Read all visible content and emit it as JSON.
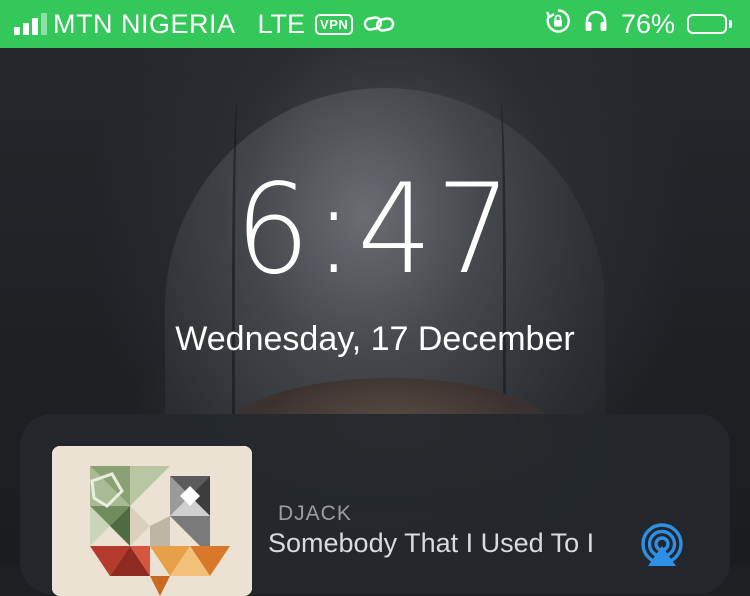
{
  "status_bar": {
    "carrier": "MTN NIGERIA",
    "network": "LTE",
    "vpn_label": "VPN",
    "battery_percent": "76%",
    "battery_level": 0.76,
    "bar_color": "#34c759"
  },
  "lock_screen": {
    "time": "6:47",
    "date": "Wednesday, 17 December"
  },
  "now_playing": {
    "artist": "DJACK",
    "title": "Somebody That I Used To I"
  },
  "icons": [
    "signal-icon",
    "link-icon",
    "rotation-lock-icon",
    "headphones-icon",
    "battery-icon",
    "airplay-icon"
  ]
}
